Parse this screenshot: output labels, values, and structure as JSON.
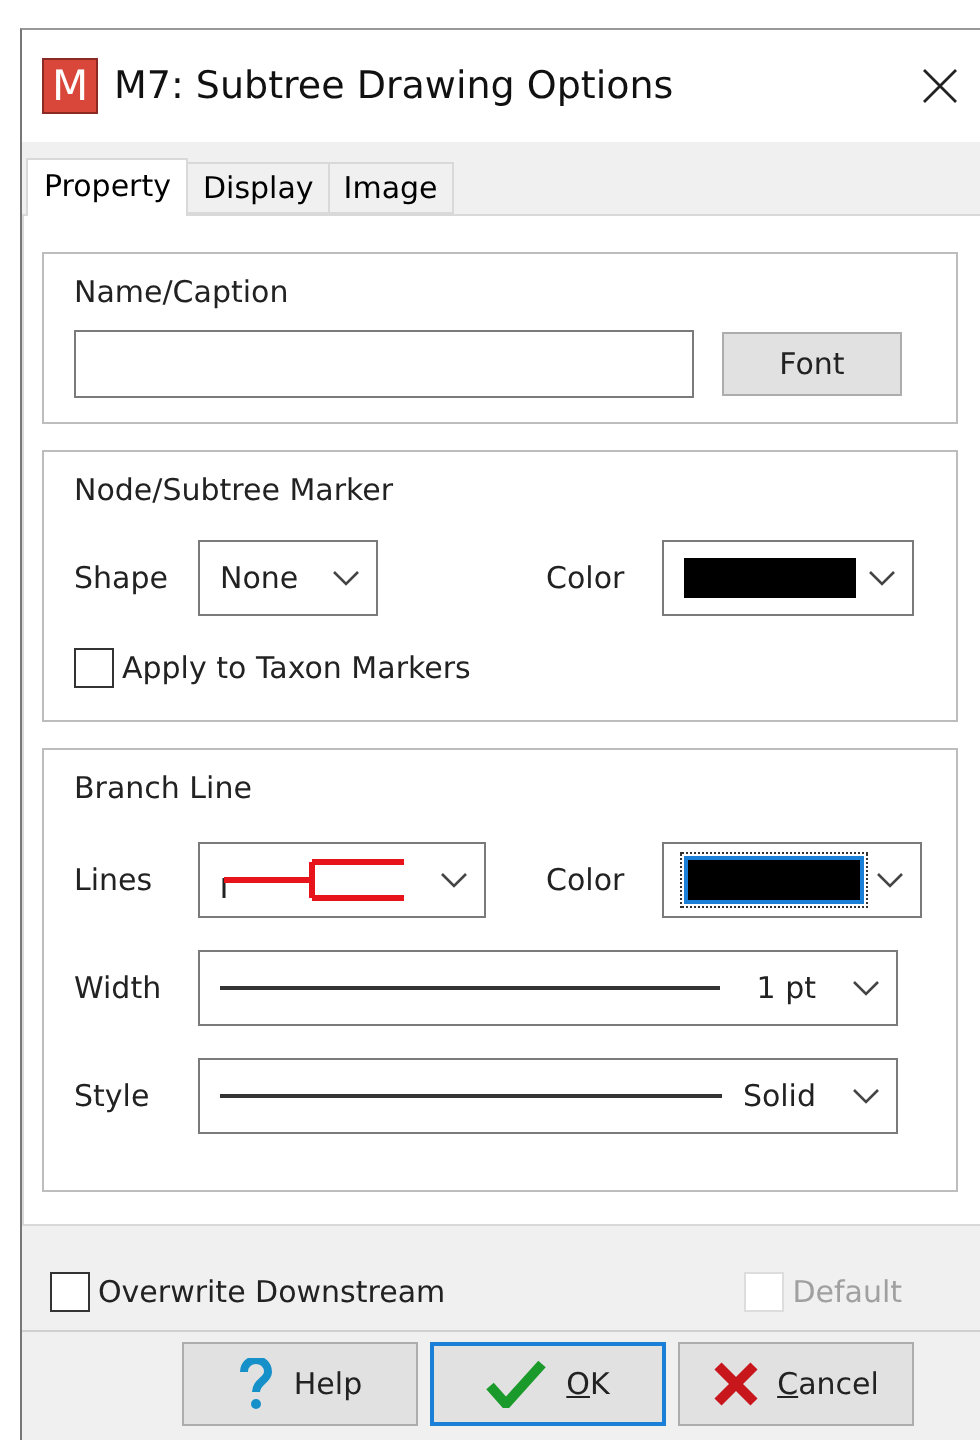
{
  "window": {
    "title": "M7: Subtree Drawing Options",
    "app_icon_letter": "M"
  },
  "tabs": [
    {
      "label": "Property",
      "selected": true
    },
    {
      "label": "Display",
      "selected": false
    },
    {
      "label": "Image",
      "selected": false
    }
  ],
  "name_caption": {
    "title": "Name/Caption",
    "button": "Font"
  },
  "marker": {
    "title": "Node/Subtree Marker",
    "shape_label": "Shape",
    "shape_value": "None",
    "color_label": "Color",
    "color": "#000000",
    "apply_label": "Apply to Taxon Markers",
    "apply_checked": false
  },
  "branch_line": {
    "title": "Branch Line",
    "lines_label": "Lines",
    "color_label": "Color",
    "color": "#000000",
    "color_focused": true,
    "width_label": "Width",
    "width_value": "1 pt",
    "style_label": "Style",
    "style_value": "Solid"
  },
  "options": [
    {
      "label": "Overwrite Downstream",
      "checked": false,
      "disabled": false
    },
    {
      "label": "Default",
      "checked": false,
      "disabled": true
    }
  ],
  "buttons": [
    {
      "kind": "help",
      "rest": "Help",
      "default": false
    },
    {
      "kind": "ok",
      "access": "O",
      "rest": "K",
      "default": true
    },
    {
      "kind": "cancel",
      "access": "C",
      "rest": "ancel",
      "default": false
    }
  ]
}
